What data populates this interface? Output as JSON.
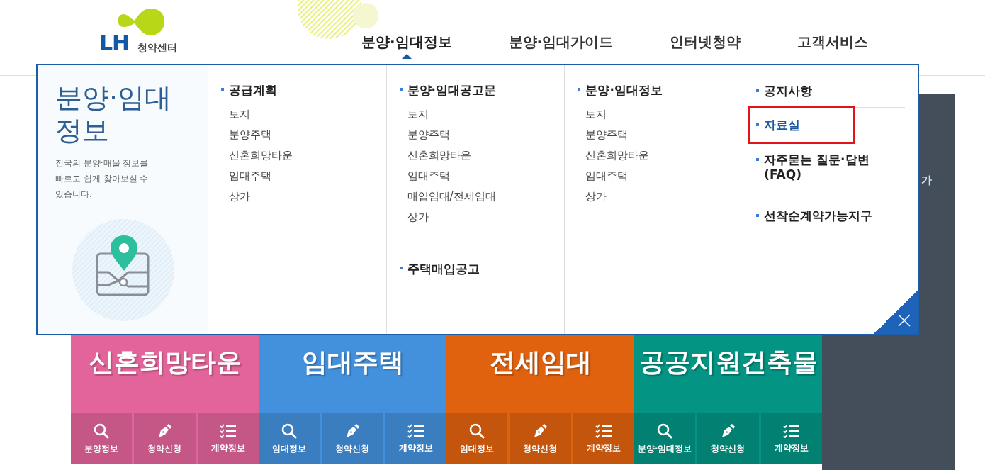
{
  "header": {
    "logo_mark": "LH",
    "logo_subtitle": "청약센터",
    "nav": [
      {
        "label": "분양·임대정보",
        "selected": true
      },
      {
        "label": "분양·임대가이드",
        "selected": false
      },
      {
        "label": "인터넷청약",
        "selected": false
      },
      {
        "label": "고객서비스",
        "selected": false
      }
    ]
  },
  "mega_menu": {
    "title": "분양·임대 정보",
    "description": "전국의 분양·매물 정보를 빠르고 쉽게 찾아보실 수 있습니다.",
    "columns": [
      {
        "groups": [
          {
            "heading": "공급계획",
            "items": [
              "토지",
              "분양주택",
              "신혼희망타운",
              "임대주택",
              "상가"
            ]
          }
        ]
      },
      {
        "groups": [
          {
            "heading": "분양·임대공고문",
            "items": [
              "토지",
              "분양주택",
              "신혼희망타운",
              "임대주택",
              "매입임대/전세임대",
              "상가"
            ]
          },
          {
            "heading": "주택매입공고"
          }
        ]
      },
      {
        "groups": [
          {
            "heading": "분양·임대정보",
            "items": [
              "토지",
              "분양주택",
              "신혼희망타운",
              "임대주택",
              "상가"
            ]
          }
        ]
      }
    ],
    "links": [
      {
        "label": "공지사항",
        "selected": false,
        "highlighted": false
      },
      {
        "label": "자료실",
        "selected": true,
        "highlighted": true
      },
      {
        "label": "자주묻는 질문·답변 (FAQ)",
        "selected": false,
        "highlighted": false
      },
      {
        "label": "선착순계약가능지구",
        "selected": false,
        "highlighted": false
      }
    ]
  },
  "tiles": [
    {
      "title": "신혼희망타운",
      "color": "#e2649a",
      "actions": [
        {
          "label": "분양정보",
          "kind": "search"
        },
        {
          "label": "청약신청",
          "kind": "pen"
        },
        {
          "label": "계약정보",
          "kind": "list"
        }
      ]
    },
    {
      "title": "임대주택",
      "color": "#4391dd",
      "actions": [
        {
          "label": "임대정보",
          "kind": "search"
        },
        {
          "label": "청약신청",
          "kind": "pen"
        },
        {
          "label": "계약정보",
          "kind": "list"
        }
      ]
    },
    {
      "title": "전세임대",
      "color": "#e0620f",
      "actions": [
        {
          "label": "임대정보",
          "kind": "search"
        },
        {
          "label": "청약신청",
          "kind": "pen"
        },
        {
          "label": "계약정보",
          "kind": "list"
        }
      ]
    },
    {
      "title": "공공지원건축물",
      "color": "#039483",
      "actions": [
        {
          "label": "분양·임대정보",
          "kind": "search"
        },
        {
          "label": "청약신청",
          "kind": "pen"
        },
        {
          "label": "계약정보",
          "kind": "list"
        }
      ]
    }
  ],
  "side_panel": {
    "text": "가"
  }
}
